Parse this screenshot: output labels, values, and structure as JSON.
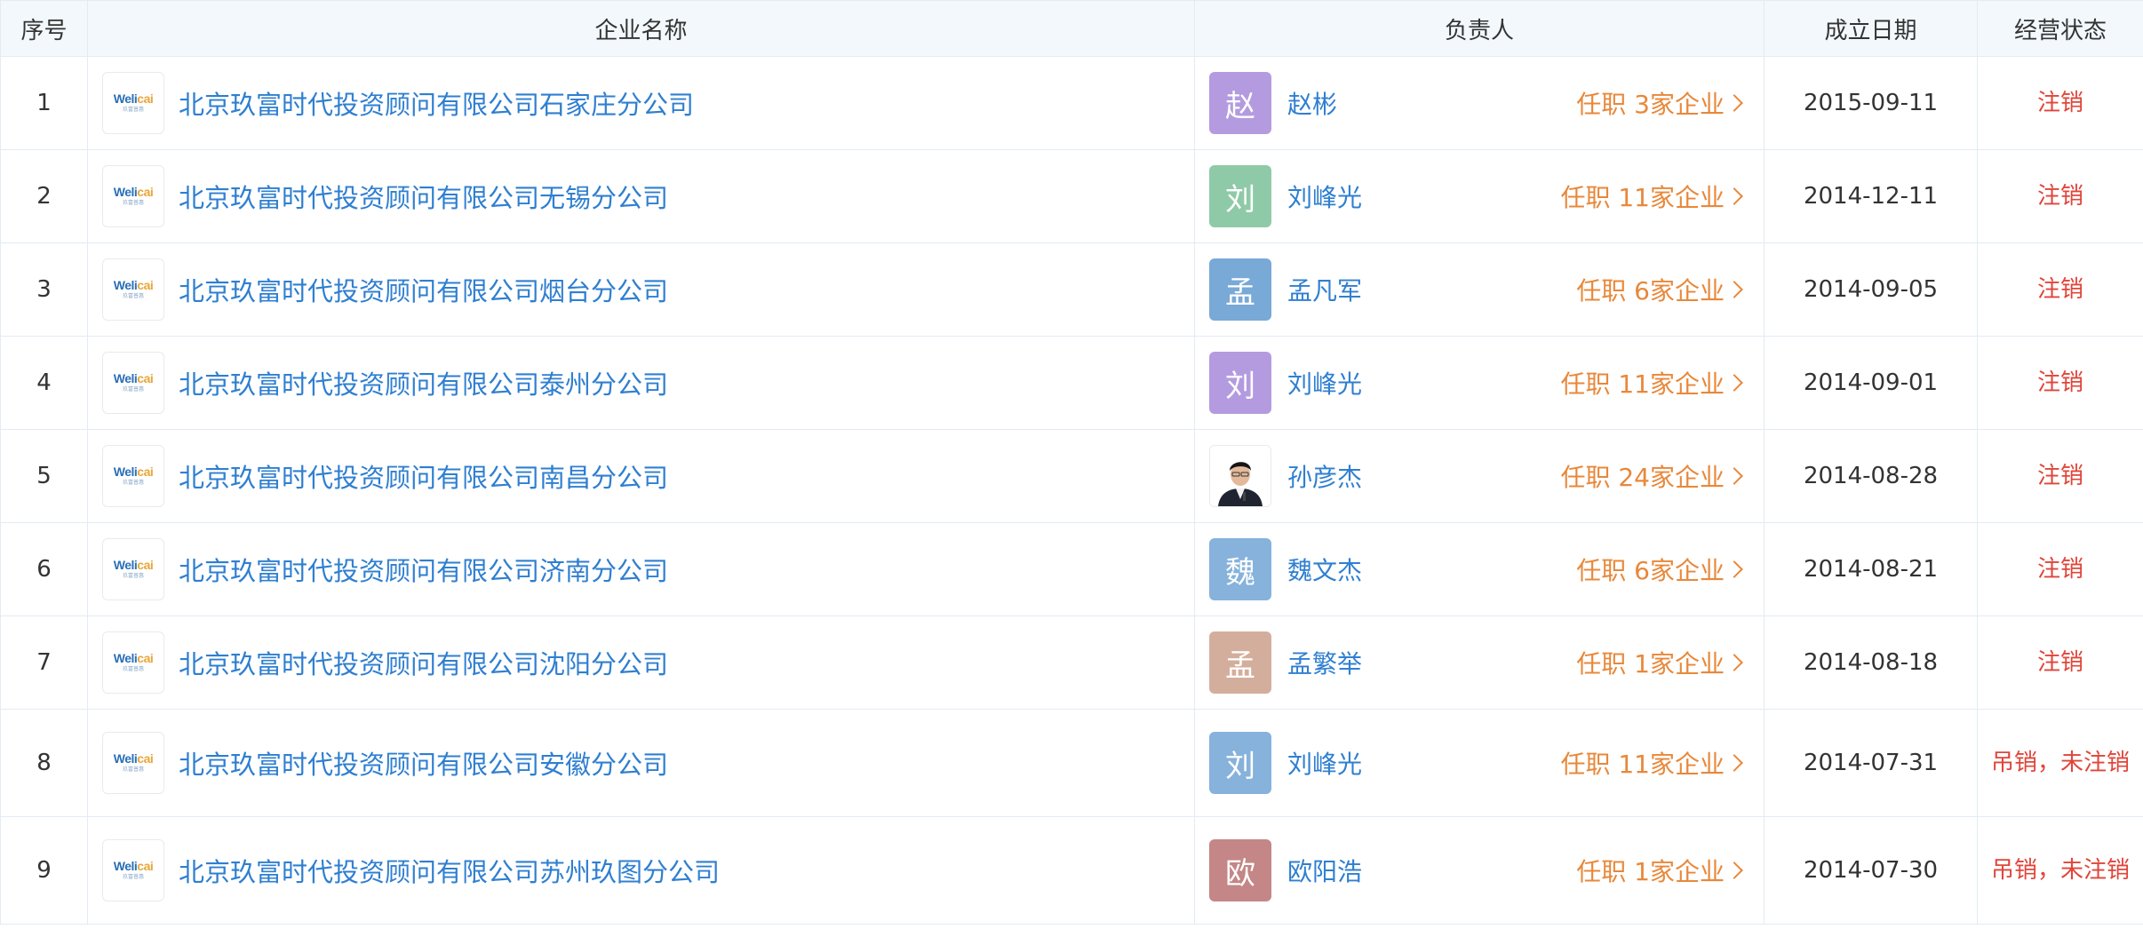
{
  "table": {
    "headers": {
      "index": "序号",
      "company": "企业名称",
      "person": "负责人",
      "date": "成立日期",
      "status": "经营状态"
    },
    "logo": {
      "word_a": "We",
      "word_b": "li",
      "word_c": "cai",
      "sub": "玖富普惠"
    },
    "rows": [
      {
        "index": "1",
        "company": "北京玖富时代投资顾问有限公司石家庄分公司",
        "avatar_char": "赵",
        "avatar_color": "#b49be0",
        "person": "赵彬",
        "positions": "任职 3家企业",
        "date": "2015-09-11",
        "status": "注销"
      },
      {
        "index": "2",
        "company": "北京玖富时代投资顾问有限公司无锡分公司",
        "avatar_char": "刘",
        "avatar_color": "#8fcaa8",
        "person": "刘峰光",
        "positions": "任职 11家企业",
        "date": "2014-12-11",
        "status": "注销"
      },
      {
        "index": "3",
        "company": "北京玖富时代投资顾问有限公司烟台分公司",
        "avatar_char": "孟",
        "avatar_color": "#79a9d6",
        "person": "孟凡军",
        "positions": "任职 6家企业",
        "date": "2014-09-05",
        "status": "注销"
      },
      {
        "index": "4",
        "company": "北京玖富时代投资顾问有限公司泰州分公司",
        "avatar_char": "刘",
        "avatar_color": "#b49be0",
        "person": "刘峰光",
        "positions": "任职 11家企业",
        "date": "2014-09-01",
        "status": "注销"
      },
      {
        "index": "5",
        "company": "北京玖富时代投资顾问有限公司南昌分公司",
        "avatar_char": "",
        "avatar_color": "#ffffff",
        "person": "孙彦杰",
        "positions": "任职 24家企业",
        "date": "2014-08-28",
        "status": "注销"
      },
      {
        "index": "6",
        "company": "北京玖富时代投资顾问有限公司济南分公司",
        "avatar_char": "魏",
        "avatar_color": "#86b2db",
        "person": "魏文杰",
        "positions": "任职 6家企业",
        "date": "2014-08-21",
        "status": "注销"
      },
      {
        "index": "7",
        "company": "北京玖富时代投资顾问有限公司沈阳分公司",
        "avatar_char": "孟",
        "avatar_color": "#d4ae9c",
        "person": "孟繁举",
        "positions": "任职 1家企业",
        "date": "2014-08-18",
        "status": "注销"
      },
      {
        "index": "8",
        "company": "北京玖富时代投资顾问有限公司安徽分公司",
        "avatar_char": "刘",
        "avatar_color": "#86b2db",
        "person": "刘峰光",
        "positions": "任职 11家企业",
        "date": "2014-07-31",
        "status": "吊销，未注销"
      },
      {
        "index": "9",
        "company": "北京玖富时代投资顾问有限公司苏州玖图分公司",
        "avatar_char": "欧",
        "avatar_color": "#c48686",
        "person": "欧阳浩",
        "positions": "任职 1家企业",
        "date": "2014-07-30",
        "status": "吊销，未注销"
      }
    ]
  }
}
